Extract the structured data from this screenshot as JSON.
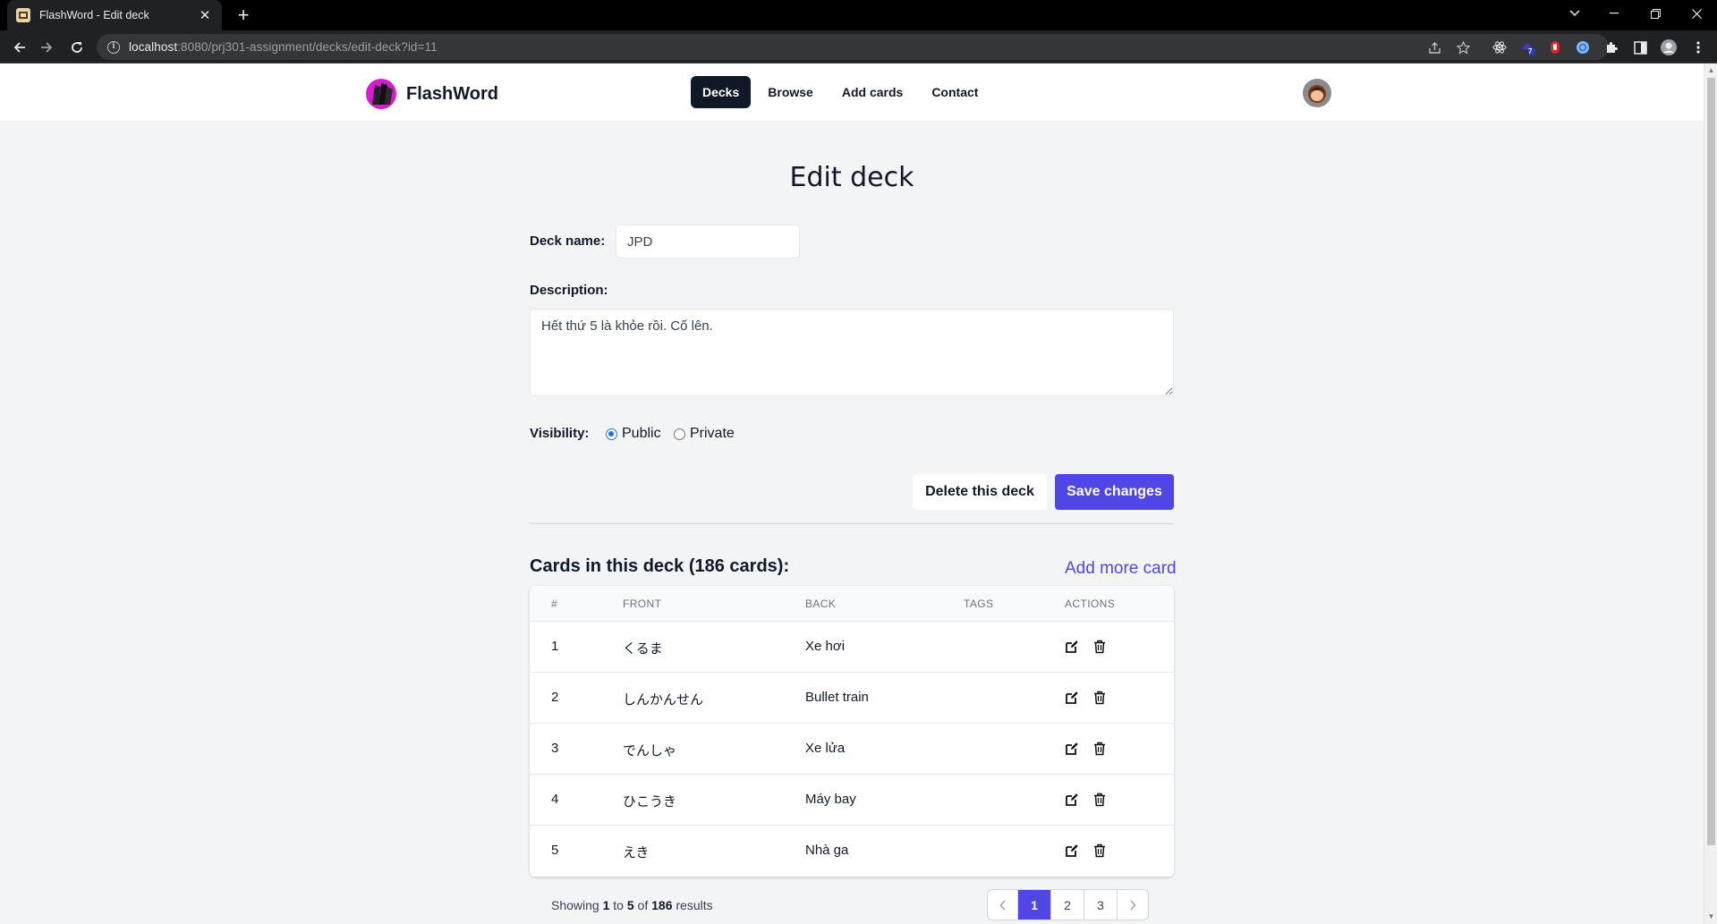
{
  "browser": {
    "tab_title": "FlashWord - Edit deck",
    "url_host": "localhost",
    "url_rest": ":8080/prj301-assignment/decks/edit-deck?id=11",
    "extension_badge": "7"
  },
  "header": {
    "brand": "FlashWord",
    "nav": [
      {
        "label": "Decks",
        "active": true
      },
      {
        "label": "Browse",
        "active": false
      },
      {
        "label": "Add cards",
        "active": false
      },
      {
        "label": "Contact",
        "active": false
      }
    ]
  },
  "form": {
    "title": "Edit deck",
    "deck_name_label": "Deck name:",
    "deck_name_value": "JPD",
    "description_label": "Description:",
    "description_value": "Hết thứ 5 là khỏe rồi. Cố lên.",
    "visibility_label": "Visibility:",
    "visibility_options": [
      "Public",
      "Private"
    ],
    "visibility_selected": "Public",
    "delete_label": "Delete this deck",
    "save_label": "Save changes"
  },
  "cards": {
    "heading": "Cards in this deck (186 cards):",
    "add_more_label": "Add more card",
    "columns": [
      "#",
      "FRONT",
      "BACK",
      "TAGS",
      "ACTIONS"
    ],
    "rows": [
      {
        "num": "1",
        "front": "くるま",
        "back": "Xe hơi",
        "tags": ""
      },
      {
        "num": "2",
        "front": "しんかんせん",
        "back": "Bullet train",
        "tags": ""
      },
      {
        "num": "3",
        "front": "でんしゃ",
        "back": "Xe lửa",
        "tags": ""
      },
      {
        "num": "4",
        "front": "ひこうき",
        "back": "Máy bay",
        "tags": ""
      },
      {
        "num": "5",
        "front": "えき",
        "back": "Nhà ga",
        "tags": ""
      }
    ]
  },
  "pagination": {
    "showing_prefix": "Showing",
    "from": "1",
    "to_word": "to",
    "to": "5",
    "of_word": "of",
    "total": "186",
    "suffix": "results",
    "pages": [
      "1",
      "2",
      "3"
    ],
    "current_page": "1"
  },
  "colors": {
    "accent": "#4f46e5",
    "nav_active_bg": "#111827",
    "page_bg": "#f3f4f6"
  }
}
